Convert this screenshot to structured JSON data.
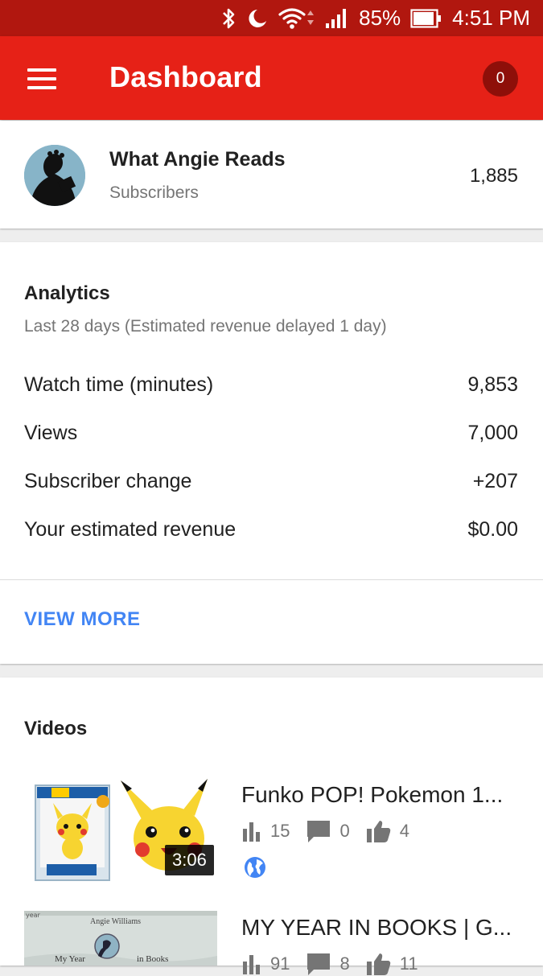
{
  "status_bar": {
    "battery_percent": "85%",
    "time": "4:51 PM",
    "icons": [
      "bluetooth-icon",
      "do-not-disturb-moon-icon",
      "wifi-icon",
      "signal-icon",
      "battery-icon"
    ]
  },
  "header": {
    "title": "Dashboard",
    "notification_count": "0",
    "menu_icon": "hamburger-menu-icon",
    "background_color": "#e62117",
    "status_bar_color": "#b1170f"
  },
  "channel": {
    "name": "What Angie Reads",
    "subscribers_label": "Subscribers",
    "subscribers_count": "1,885"
  },
  "analytics": {
    "title": "Analytics",
    "subtitle": "Last 28 days (Estimated revenue delayed 1 day)",
    "metrics": [
      {
        "label": "Watch time (minutes)",
        "value": "9,853"
      },
      {
        "label": "Views",
        "value": "7,000"
      },
      {
        "label": "Subscriber change",
        "value": "+207"
      },
      {
        "label": "Your estimated revenue",
        "value": "$0.00"
      }
    ],
    "view_more_label": "VIEW MORE",
    "link_color": "#4285f4"
  },
  "videos": {
    "title": "Videos",
    "items": [
      {
        "title": "Funko POP! Pokemon 1...",
        "views": "15",
        "comments": "0",
        "likes": "4",
        "duration": "3:06",
        "visibility_icon": "globe-public-icon"
      },
      {
        "title": "MY YEAR IN BOOKS | G...",
        "views": "91",
        "comments": "8",
        "likes": "11",
        "thumb_text_top": "Angie Williams",
        "thumb_text_left": "My Year",
        "thumb_text_right": "in Books",
        "thumb_corner": "year"
      }
    ]
  }
}
